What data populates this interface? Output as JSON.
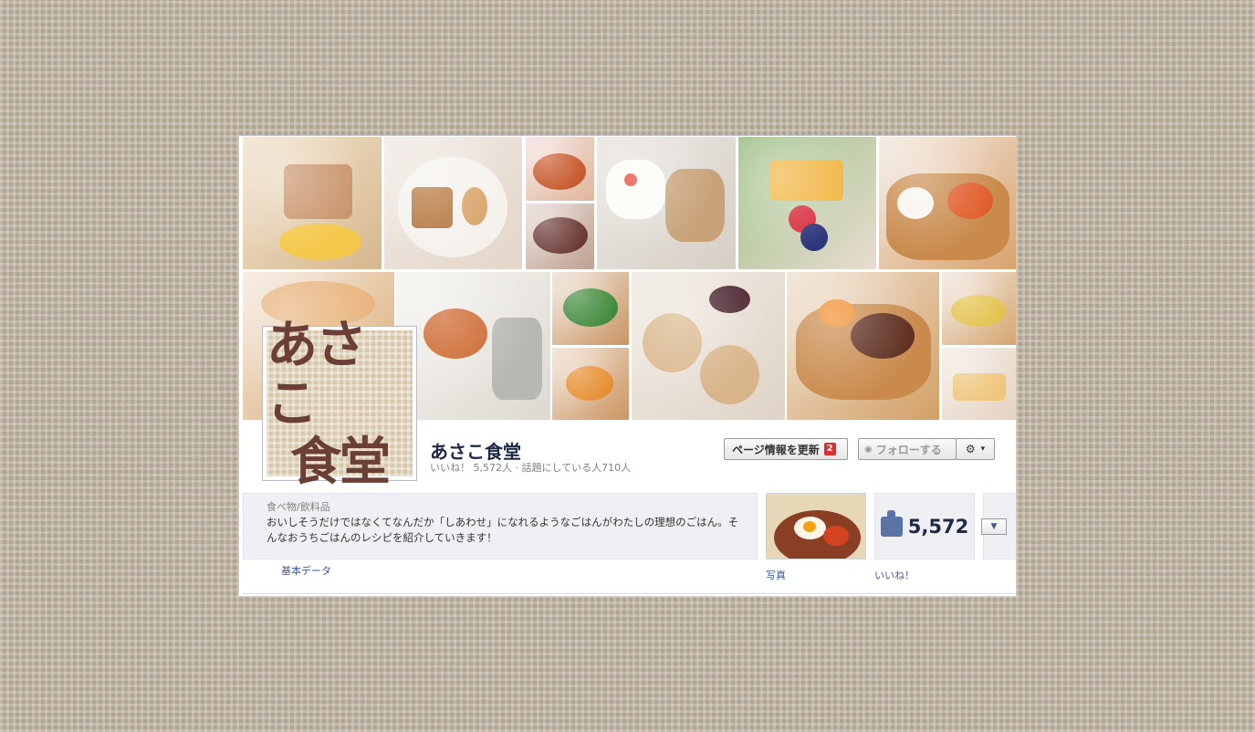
{
  "page": {
    "name": "あさこ食堂",
    "stats": "いいね！ 5,572人 · 話題にしている人710人",
    "logo_text": "あさこ食堂",
    "logo_lines": [
      "あさこ",
      "食堂"
    ]
  },
  "buttons": {
    "update_label": "ページ情報を更新",
    "update_badge": "2",
    "follow_label": "フォローする",
    "gear_icon": "gear-icon"
  },
  "about": {
    "category": "食べ物/飲料品",
    "description": "おいしそうだけではなくてなんだか「しあわせ」になれるようなごはんがわたしの理想のごはん。そんなおうちごはんのレシピを紹介していきます！",
    "basic_link": "基本データ"
  },
  "apps": {
    "photos_label": "写真",
    "likes_count": "5,572",
    "likes_label": "いいね！"
  },
  "colors": {
    "link": "#3b5998",
    "name": "#1c2a47",
    "badge": "#e02c2c",
    "logo": "#6b3f36"
  }
}
